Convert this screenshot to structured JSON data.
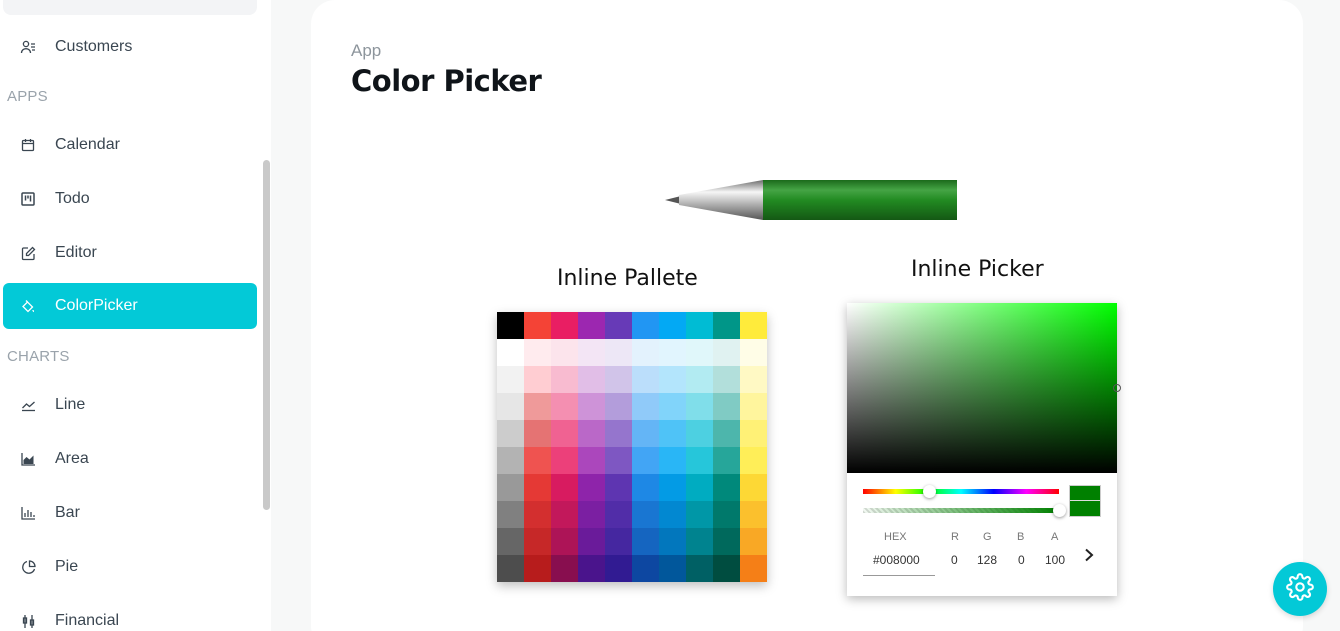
{
  "sidebar": {
    "items_top": [
      {
        "label": "Customers",
        "icon": "customers-icon"
      }
    ],
    "sections": [
      {
        "title": "APPS"
      },
      {
        "title": "CHARTS"
      }
    ],
    "apps": [
      {
        "label": "Calendar",
        "icon": "calendar-icon"
      },
      {
        "label": "Todo",
        "icon": "kanban-icon"
      },
      {
        "label": "Editor",
        "icon": "edit-icon"
      },
      {
        "label": "ColorPicker",
        "icon": "color-fill-icon",
        "active": true
      }
    ],
    "charts": [
      {
        "label": "Line",
        "icon": "line-chart-icon"
      },
      {
        "label": "Area",
        "icon": "area-chart-icon"
      },
      {
        "label": "Bar",
        "icon": "bar-chart-icon"
      },
      {
        "label": "Pie",
        "icon": "pie-chart-icon"
      },
      {
        "label": "Financial",
        "icon": "financial-icon"
      }
    ],
    "accent": "#03c9d7"
  },
  "header": {
    "breadcrumb": "App",
    "title": "Color Picker"
  },
  "pen": {
    "color": "#1e7a1e"
  },
  "palette_section": {
    "title": "Inline Pallete",
    "columns": [
      [
        "#000000",
        "#ffffff",
        "#f2f2f2",
        "#e6e6e6",
        "#cccccc",
        "#b3b3b3",
        "#999999",
        "#808080",
        "#666666",
        "#4d4d4d"
      ],
      [
        "#f44336",
        "#ffebee",
        "#ffcdd2",
        "#ef9a9a",
        "#e57373",
        "#ef5350",
        "#e53935",
        "#d32f2f",
        "#c62828",
        "#b71c1c"
      ],
      [
        "#e91e63",
        "#fce4ec",
        "#f8bbd0",
        "#f48fb1",
        "#f06292",
        "#ec407a",
        "#d81b60",
        "#c2185b",
        "#ad1457",
        "#880e4f"
      ],
      [
        "#9c27b0",
        "#f3e5f5",
        "#e1bee7",
        "#ce93d8",
        "#ba68c8",
        "#ab47bc",
        "#8e24aa",
        "#7b1fa2",
        "#6a1b9a",
        "#4a148c"
      ],
      [
        "#673ab7",
        "#ede7f6",
        "#d1c4e9",
        "#b39ddb",
        "#9575cd",
        "#7e57c2",
        "#5e35b1",
        "#512da8",
        "#4527a0",
        "#311b92"
      ],
      [
        "#2196f3",
        "#e3f2fd",
        "#bbdefb",
        "#90caf9",
        "#64b5f6",
        "#42a5f5",
        "#1e88e5",
        "#1976d2",
        "#1565c0",
        "#0d47a1"
      ],
      [
        "#03a9f4",
        "#e1f5fe",
        "#b3e5fc",
        "#81d4fa",
        "#4fc3f7",
        "#29b6f6",
        "#039be5",
        "#0288d1",
        "#0277bd",
        "#01579b"
      ],
      [
        "#00bcd4",
        "#e0f7fa",
        "#b2ebf2",
        "#80deea",
        "#4dd0e1",
        "#26c6da",
        "#00acc1",
        "#0097a7",
        "#00838f",
        "#006064"
      ],
      [
        "#009688",
        "#e0f2f1",
        "#b2dfdb",
        "#80cbc4",
        "#4db6ac",
        "#26a69a",
        "#00897b",
        "#00796b",
        "#00695c",
        "#004d40"
      ],
      [
        "#ffeb3b",
        "#fffde7",
        "#fff9c4",
        "#fff59d",
        "#fff176",
        "#ffee58",
        "#fdd835",
        "#fbc02d",
        "#f9a825",
        "#f57f17"
      ]
    ]
  },
  "picker_section": {
    "title": "Inline Picker",
    "hue_base": "#00ff00",
    "labels": {
      "hex": "HEX",
      "r": "R",
      "g": "G",
      "b": "B",
      "a": "A"
    },
    "values": {
      "hex": "#008000",
      "r": "0",
      "g": "128",
      "b": "0",
      "a": "100"
    },
    "selected_color": "#008000"
  },
  "settings": {
    "icon": "gear-icon"
  }
}
